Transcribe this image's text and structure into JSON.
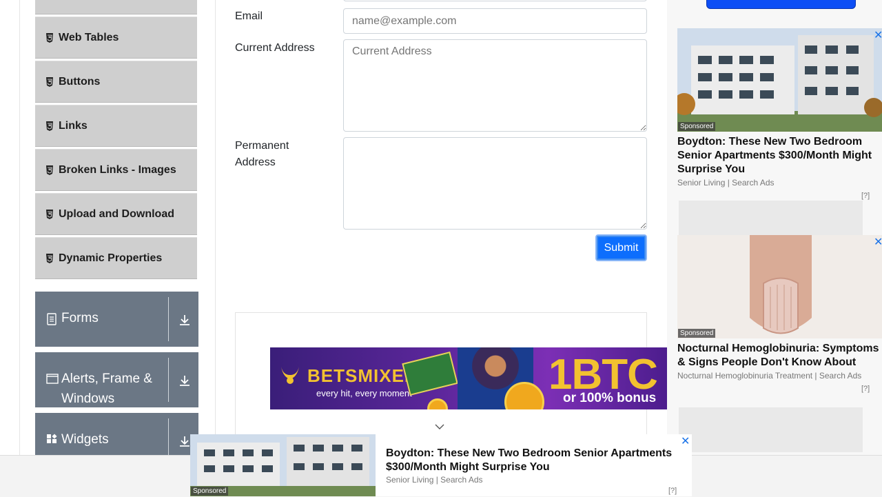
{
  "sidebar": {
    "items": [
      {
        "label": ""
      },
      {
        "label": "Web Tables"
      },
      {
        "label": "Buttons"
      },
      {
        "label": "Links"
      },
      {
        "label": "Broken Links - Images"
      },
      {
        "label": "Upload and Download"
      },
      {
        "label": "Dynamic Properties"
      }
    ],
    "groups": [
      {
        "label": "Forms",
        "icon": "form-icon"
      },
      {
        "label": "Alerts, Frame &",
        "label2": "Windows",
        "icon": "window-icon"
      },
      {
        "label": "Widgets",
        "icon": "widgets-icon"
      }
    ]
  },
  "form": {
    "email_label": "Email",
    "email_placeholder": "name@example.com",
    "current_address_label": "Current Address",
    "current_address_placeholder": "Current Address",
    "permanent_address_label": "Permanent",
    "permanent_address_label2": "Address",
    "submit_label": "Submit"
  },
  "banner": {
    "brand": "BETSMIXER",
    "tagline": "every hit, every moment",
    "headline": "1BTC",
    "subline": "or 100% bonus"
  },
  "ads": [
    {
      "sponsored": "Sponsored",
      "title": "Boydton: These New Two Bedroom Senior Apartments $300/Month Might Surprise You",
      "source": "Senior Living | Search Ads"
    },
    {
      "sponsored": "Sponsored",
      "title": "Nocturnal Hemoglobinuria: Symptoms & Signs People Don't Know About",
      "source": "Nocturnal Hemoglobinuria Treatment | Search Ads"
    }
  ],
  "sticky_ad": {
    "sponsored": "Sponsored",
    "title": "Boydton: These New Two Bedroom Senior Apartments $300/Month Might Surprise You",
    "source": "Senior Living | Search Ads"
  },
  "adchoices": "[?]",
  "close_glyph": "✕",
  "colors": {
    "accent": "#0d6efd",
    "sidebar_item_bg": "#cfcfcf",
    "group_bg": "#6b7785"
  }
}
